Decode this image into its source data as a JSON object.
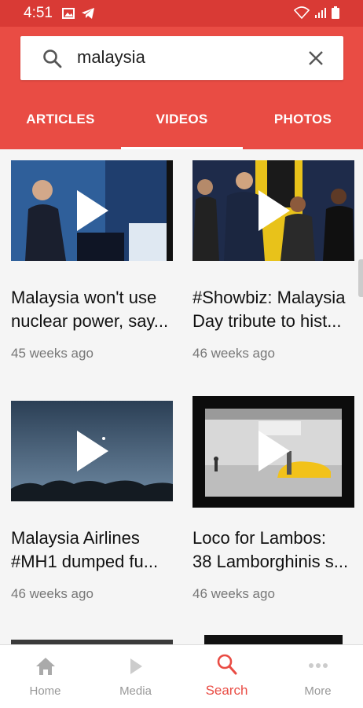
{
  "status": {
    "time": "4:51"
  },
  "search": {
    "value": "malaysia"
  },
  "tabs": [
    {
      "label": "ARTICLES"
    },
    {
      "label": "VIDEOS"
    },
    {
      "label": "PHOTOS"
    }
  ],
  "videos": [
    {
      "title_line1": "Malaysia won't use",
      "title_line2": "nuclear power, say...",
      "time": "45 weeks ago"
    },
    {
      "title_line1": "#Showbiz: Malaysia",
      "title_line2": "Day tribute to hist...",
      "time": "46 weeks ago"
    },
    {
      "title_line1": "Malaysia Airlines",
      "title_line2": "#MH1 dumped fu...",
      "time": "46 weeks ago"
    },
    {
      "title_line1": "Loco for Lambos:",
      "title_line2": "38 Lamborghinis s...",
      "time": "46 weeks ago"
    }
  ],
  "nav": [
    {
      "label": "Home",
      "icon": "home-icon"
    },
    {
      "label": "Media",
      "icon": "play-icon"
    },
    {
      "label": "Search",
      "icon": "search-icon"
    },
    {
      "label": "More",
      "icon": "more-dots-icon"
    }
  ],
  "colors": {
    "primary": "#e94c44",
    "statusbar": "#d93a35",
    "active": "#e94c44",
    "inactive": "#999999"
  }
}
